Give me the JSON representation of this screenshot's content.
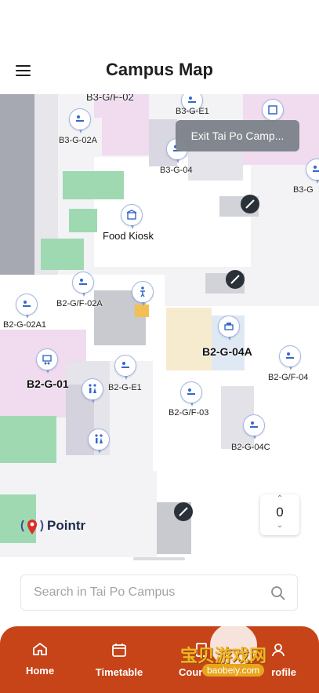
{
  "header": {
    "title": "Campus Map",
    "menu_icon": "hamburger-icon"
  },
  "map": {
    "exit_button": "Exit Tai Po Camp...",
    "labels": [
      "B3-G/F-02",
      "B3-G-E1",
      "B3-G-02A",
      "B3-G-04",
      "B3-G",
      "Food Kiosk",
      "B2-G/F-02A",
      "B2-G-02A1",
      "B2-G-04A",
      "B2-G/F-04",
      "B2-G-01",
      "B2-G-E1",
      "B2-G/F-03",
      "B2-G-04C"
    ],
    "floor_selector": {
      "value": "0",
      "up_icon": "chevron-up-icon",
      "down_icon": "chevron-down-icon"
    },
    "logo": "Pointr",
    "colors": {
      "room_pink": "#efdcef",
      "room_green": "#9fd9b2",
      "room_beige": "#f7ebcf",
      "dark_wall": "#a3a6ae"
    }
  },
  "search": {
    "placeholder": "Search in Tai Po Campus",
    "icon": "search-icon"
  },
  "tabs": [
    {
      "label": "Home",
      "icon": "home-icon"
    },
    {
      "label": "Timetable",
      "icon": "calendar-icon"
    },
    {
      "label": "Cour",
      "icon": "course-icon"
    },
    {
      "label": "rofile",
      "icon": "profile-icon"
    }
  ],
  "watermark": {
    "text": "宝贝游戏网",
    "url": "baobeiy.com"
  },
  "colors": {
    "accent": "#c74419"
  }
}
